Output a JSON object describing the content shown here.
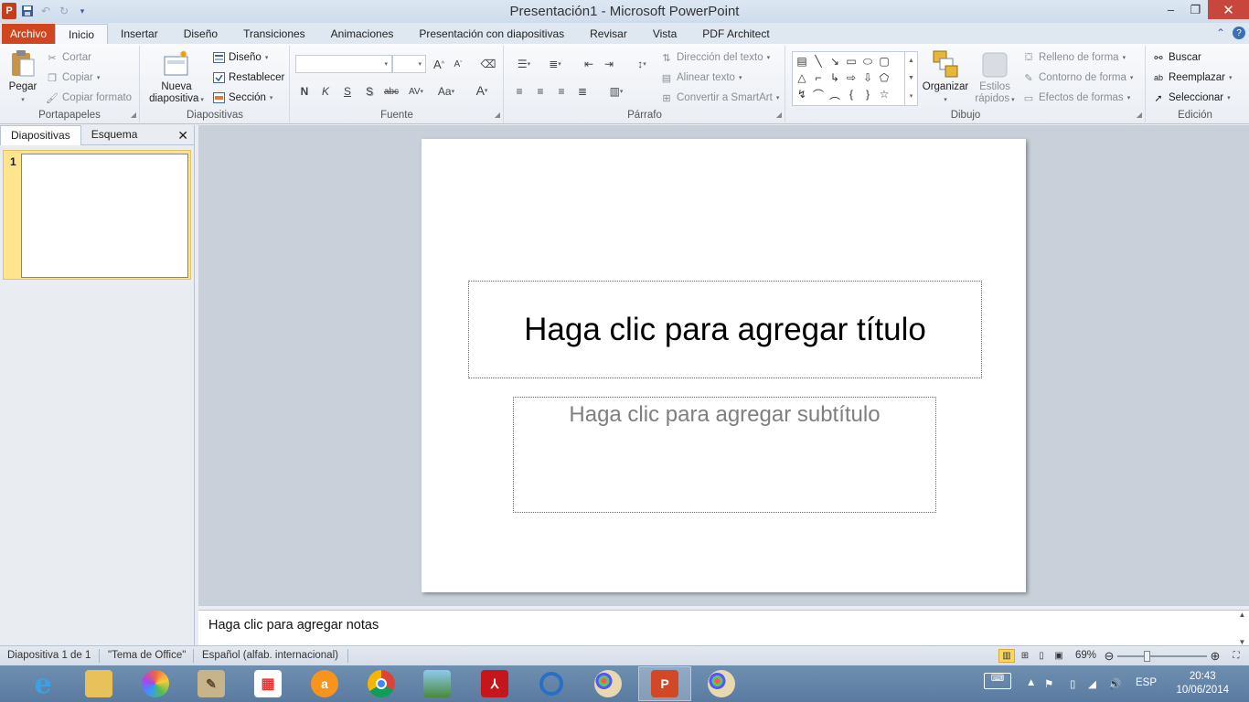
{
  "window": {
    "title": "Presentación1 - Microsoft PowerPoint",
    "minimize": "–",
    "maximize": "❐",
    "close": "✕"
  },
  "tabs": {
    "file": "Archivo",
    "items": [
      "Inicio",
      "Insertar",
      "Diseño",
      "Transiciones",
      "Animaciones",
      "Presentación con diapositivas",
      "Revisar",
      "Vista",
      "PDF Architect"
    ],
    "active": "Inicio"
  },
  "clipboard": {
    "group": "Portapapeles",
    "paste": "Pegar",
    "cut": "Cortar",
    "copy": "Copiar",
    "format_painter": "Copiar formato"
  },
  "slides": {
    "group": "Diapositivas",
    "new_slide_1": "Nueva",
    "new_slide_2": "diapositiva",
    "layout": "Diseño",
    "reset": "Restablecer",
    "section": "Sección"
  },
  "font": {
    "group": "Fuente",
    "font_name": "",
    "font_size": "",
    "bold": "N",
    "italic": "K",
    "underline": "S",
    "shadow": "S",
    "strike": "abc",
    "spacing": "AV",
    "case": "Aa",
    "color": "A",
    "grow": "A",
    "shrink": "A"
  },
  "paragraph": {
    "group": "Párrafo",
    "text_direction": "Dirección del texto",
    "align_text": "Alinear texto",
    "smartart": "Convertir a SmartArt"
  },
  "drawing": {
    "group": "Dibujo",
    "arrange": "Organizar",
    "quick_styles_1": "Estilos",
    "quick_styles_2": "rápidos",
    "shape_fill": "Relleno de forma",
    "shape_outline": "Contorno de forma",
    "shape_effects": "Efectos de formas"
  },
  "editing": {
    "group": "Edición",
    "find": "Buscar",
    "replace": "Reemplazar",
    "select": "Seleccionar"
  },
  "left_pane": {
    "tab_slides": "Diapositivas",
    "tab_outline": "Esquema",
    "close": "✕",
    "slide_number": "1"
  },
  "slide": {
    "title_placeholder": "Haga clic para agregar título",
    "subtitle_placeholder": "Haga clic para agregar subtítulo"
  },
  "notes": {
    "placeholder": "Haga clic para agregar notas"
  },
  "status": {
    "slide_info": "Diapositiva 1 de 1",
    "theme": "\"Tema de Office\"",
    "language": "Español (alfab. internacional)",
    "zoom": "69%",
    "zoom_level": 0.69
  },
  "taskbar": {
    "apps": [
      "internet-explorer",
      "file-explorer",
      "picasa",
      "notepad-scroll",
      "apps-grid",
      "avast",
      "chrome",
      "photo-viewer",
      "acrobat",
      "circle-app",
      "paint",
      "powerpoint",
      "paint-2"
    ],
    "active": "powerpoint",
    "language": "ESP",
    "time": "20:43",
    "date": "10/06/2014"
  },
  "colors": {
    "file_tab": "#d2461f",
    "accent": "#2b579a",
    "selection": "#fbd85d"
  }
}
